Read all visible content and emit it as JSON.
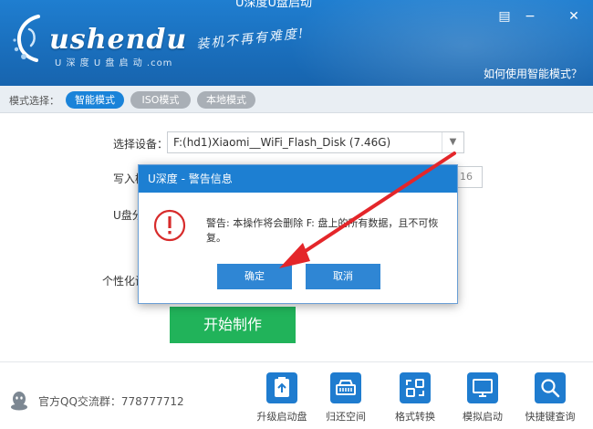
{
  "header": {
    "title_partial": "U深度U盘启动",
    "logo_text": "ushendu",
    "logo_sub": "U 深 度 U 盘 启 动 .com",
    "slogan": "装机不再有难度!",
    "help_link": "如何使用智能模式？",
    "colors": {
      "accent": "#1a83d9",
      "header_bg": "#1a6fbd"
    }
  },
  "window_controls": [
    {
      "icon": "menu-icon",
      "glyph": "▤"
    },
    {
      "icon": "minimize-icon",
      "glyph": "−"
    },
    {
      "icon": "close-icon",
      "glyph": "✕"
    }
  ],
  "mode_bar": {
    "label": "模式选择：",
    "modes": [
      {
        "label": "智能模式",
        "active": true
      },
      {
        "label": "ISO模式",
        "active": false
      },
      {
        "label": "本地模式",
        "active": false
      }
    ]
  },
  "form": {
    "device_label": "选择设备：",
    "device_value": "F:(hd1)Xiaomi__WiFi_Flash_Disk (7.46G)",
    "write_label_partial": "写入模",
    "partition_label_partial": "U盘分",
    "personalize_label_partial": "个性化设",
    "small_input_value": "16"
  },
  "start_button": {
    "label": "开始制作",
    "color": "#21b35a"
  },
  "footer": {
    "qq_text": "官方QQ交流群：778777712",
    "tools": [
      {
        "label": "升级启动盘",
        "icon": "upgrade-disk-icon"
      },
      {
        "label": "归还空间",
        "icon": "restore-space-icon"
      },
      {
        "label": "格式转换",
        "icon": "format-convert-icon"
      },
      {
        "label": "模拟启动",
        "icon": "simulate-boot-icon"
      },
      {
        "label": "快捷键查询",
        "icon": "hotkey-search-icon"
      }
    ]
  },
  "dialog": {
    "title": "U深度 - 警告信息",
    "message": "警告: 本操作将会删除 F: 盘上的所有数据，且不可恢复。",
    "ok_label": "确定",
    "cancel_label": "取消",
    "icon": "warning-icon"
  }
}
